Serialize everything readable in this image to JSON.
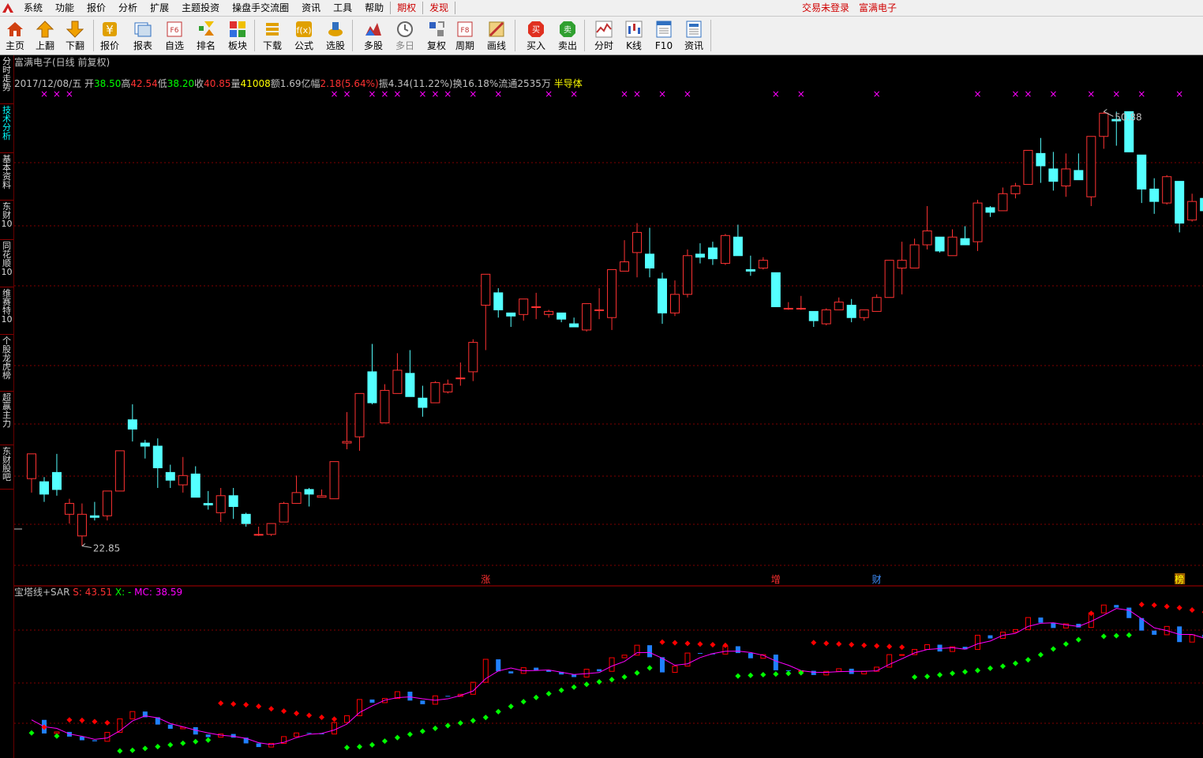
{
  "menubar": {
    "items": [
      "系统",
      "功能",
      "报价",
      "分析",
      "扩展",
      "主题投资",
      "操盘手交流圈",
      "资讯",
      "工具",
      "帮助"
    ],
    "highlight_items": [
      "期权",
      "发现"
    ],
    "login_status": "交易未登录",
    "stock_name": "富满电子"
  },
  "toolbar": {
    "buttons": [
      {
        "label": "主页",
        "icon": "home-icon",
        "color": "#d04010"
      },
      {
        "label": "上翻",
        "icon": "arrow-up-icon",
        "color": "#f0a000"
      },
      {
        "label": "下翻",
        "icon": "arrow-down-icon",
        "color": "#f0a000"
      },
      {
        "label": "报价",
        "icon": "yen-icon",
        "color": "#e0a000"
      },
      {
        "label": "报表",
        "icon": "report-icon",
        "color": "#3070c0"
      },
      {
        "label": "自选",
        "icon": "f6-icon",
        "color": "#c03030"
      },
      {
        "label": "排名",
        "icon": "rank-icon",
        "color": "#e08000"
      },
      {
        "label": "板块",
        "icon": "blocks-icon",
        "color": "#30a030"
      },
      {
        "label": "下载",
        "icon": "download-icon",
        "color": "#e0a000"
      },
      {
        "label": "公式",
        "icon": "formula-icon",
        "color": "#e0a000"
      },
      {
        "label": "选股",
        "icon": "select-stock-icon",
        "color": "#e0a000"
      },
      {
        "label": "多股",
        "icon": "multi-stock-icon",
        "color": "#c03030"
      },
      {
        "label": "多日",
        "icon": "multi-day-icon",
        "color": "#666666",
        "disabled": true
      },
      {
        "label": "复权",
        "icon": "restore-rights-icon",
        "color": "#3060c0"
      },
      {
        "label": "周期",
        "icon": "f8-icon",
        "color": "#c03030"
      },
      {
        "label": "画线",
        "icon": "draw-line-icon",
        "color": "#c03030"
      },
      {
        "label": "买入",
        "icon": "buy-icon",
        "color": "#e03020",
        "glyph": "买"
      },
      {
        "label": "卖出",
        "icon": "sell-icon",
        "color": "#30a030",
        "glyph": "卖"
      },
      {
        "label": "分时",
        "icon": "timeshare-icon",
        "color": "#c03030"
      },
      {
        "label": "K线",
        "icon": "kline-icon",
        "color": "#3060c0"
      },
      {
        "label": "F10",
        "icon": "f10-icon",
        "color": "#3070c0"
      },
      {
        "label": "资讯",
        "icon": "news-icon",
        "color": "#3070c0"
      }
    ]
  },
  "side_tabs": [
    {
      "label": "分时走势",
      "active": false
    },
    {
      "label": "技术分析",
      "active": true
    },
    {
      "label": "基本资料",
      "active": false
    },
    {
      "label": "东财10",
      "active": false
    },
    {
      "label": "同花顺10",
      "active": false
    },
    {
      "label": "维赛特10",
      "active": false
    },
    {
      "label": "个股龙虎榜",
      "active": false
    },
    {
      "label": "超赢主力",
      "active": false
    },
    {
      "label": "东财股吧",
      "active": false
    }
  ],
  "chart_header": {
    "title": "富满电子(日线 前复权)",
    "date": "2017/12/08/五",
    "open_label": "开",
    "open": "38.50",
    "high_label": "高",
    "high": "42.54",
    "low_label": "低",
    "low": "38.20",
    "close_label": "收",
    "close": "40.85",
    "volume_label": "量",
    "volume": "41008",
    "amount_label": "额",
    "amount": "1.69亿",
    "change_label": "幅",
    "change": "2.18(5.64%)",
    "amplitude_label": "振",
    "amplitude": "4.34(11.22%)",
    "turnover_label": "换",
    "turnover": "16.18%",
    "float_label": "流通",
    "float": "2535万",
    "sector": "半导体"
  },
  "colors": {
    "up": "#ff3232",
    "down": "#54ffff",
    "grid": "#800000",
    "ma": "#ff00ff",
    "sar_up": "#00ff00",
    "sar_down": "#ff0000",
    "tower_down": "#2080ff",
    "background": "#000000"
  },
  "event_markers": [
    {
      "label": "涨",
      "color": "#ff3030"
    },
    {
      "label": "增",
      "color": "#ff3030"
    },
    {
      "label": "财",
      "color": "#4090ff"
    },
    {
      "label": "榜",
      "color": "#ffff00",
      "bg": "#a06000"
    }
  ],
  "indicator_header": {
    "name": "宝塔线+SAR",
    "s_label": "S:",
    "s_value": "43.51",
    "x_label": "X:",
    "x_value": "-",
    "mc_label": "MC:",
    "mc_value": "38.59"
  },
  "chart_data": {
    "type": "candlestick",
    "y_range": [
      21.5,
      52.5
    ],
    "max_label": "50.88",
    "min_label": "22.85",
    "candles": [
      [
        27.2,
        28.8,
        26.3,
        27.4
      ],
      [
        27.0,
        26.2,
        25.7,
        27.3
      ],
      [
        27.6,
        26.5,
        26.1,
        28.8
      ],
      [
        24.9,
        25.6,
        24.3,
        25.9
      ],
      [
        23.5,
        24.9,
        22.85,
        25.6
      ],
      [
        24.8,
        24.7,
        24.5,
        25.7
      ],
      [
        24.8,
        26.4,
        24.5,
        26.4
      ],
      [
        26.4,
        29.0,
        26.4,
        29.0
      ],
      [
        31.0,
        30.4,
        29.6,
        32.0
      ],
      [
        29.5,
        29.3,
        28.5,
        29.7
      ],
      [
        29.3,
        27.9,
        26.6,
        29.8
      ],
      [
        27.6,
        27.1,
        26.6,
        28.1
      ],
      [
        26.8,
        27.4,
        26.3,
        28.6
      ],
      [
        27.5,
        26.0,
        26.0,
        28.0
      ],
      [
        25.6,
        25.5,
        25.2,
        26.4
      ],
      [
        25.0,
        26.1,
        24.4,
        26.6
      ],
      [
        26.1,
        25.4,
        24.6,
        26.6
      ],
      [
        24.9,
        24.3,
        24.1,
        25.0
      ],
      [
        23.6,
        23.6,
        23.5,
        24.1
      ],
      [
        23.6,
        24.3,
        23.5,
        24.3
      ],
      [
        24.4,
        25.6,
        24.4,
        25.7
      ],
      [
        25.6,
        26.3,
        25.6,
        27.4
      ],
      [
        26.5,
        26.2,
        25.4,
        26.6
      ],
      [
        26.0,
        26.1,
        26.0,
        26.5
      ],
      [
        25.9,
        28.3,
        25.9,
        28.3
      ],
      [
        29.5,
        29.6,
        29.1,
        31.5
      ],
      [
        29.9,
        32.7,
        29.0,
        32.7
      ],
      [
        34.1,
        32.1,
        32.0,
        35.9
      ],
      [
        30.8,
        32.9,
        30.8,
        33.3
      ],
      [
        32.7,
        34.2,
        32.7,
        35.3
      ],
      [
        34.0,
        32.5,
        32.5,
        35.5
      ],
      [
        32.4,
        31.8,
        31.2,
        33.2
      ],
      [
        32.1,
        33.4,
        32.1,
        33.5
      ],
      [
        32.8,
        33.3,
        32.7,
        33.6
      ],
      [
        33.7,
        33.7,
        33.2,
        34.7
      ],
      [
        34.1,
        36.0,
        33.5,
        36.2
      ],
      [
        38.4,
        40.4,
        35.5,
        40.4
      ],
      [
        39.2,
        38.1,
        37.6,
        39.5
      ],
      [
        37.9,
        37.7,
        37.0,
        37.9
      ],
      [
        37.8,
        38.8,
        37.4,
        38.8
      ],
      [
        38.3,
        38.3,
        37.5,
        39.2
      ],
      [
        37.8,
        38.0,
        37.6,
        38.1
      ],
      [
        37.9,
        37.5,
        37.3,
        37.9
      ],
      [
        37.2,
        37.0,
        37.0,
        37.6
      ],
      [
        36.8,
        38.5,
        36.7,
        38.5
      ],
      [
        38.1,
        38.1,
        37.5,
        39.5
      ],
      [
        37.6,
        40.7,
        36.8,
        40.7
      ],
      [
        40.6,
        41.2,
        40.6,
        42.6
      ],
      [
        41.8,
        43.1,
        40.2,
        43.7
      ],
      [
        41.7,
        40.8,
        40.2,
        43.4
      ],
      [
        40.1,
        37.9,
        37.2,
        40.5
      ],
      [
        37.9,
        39.1,
        37.7,
        40.0
      ],
      [
        39.1,
        41.6,
        38.9,
        42.0
      ],
      [
        41.7,
        41.5,
        41.1,
        42.4
      ],
      [
        42.1,
        41.4,
        41.0,
        42.5
      ],
      [
        41.1,
        42.9,
        41.0,
        43.0
      ],
      [
        42.8,
        41.6,
        41.6,
        43.6
      ],
      [
        40.7,
        40.6,
        40.3,
        41.6
      ],
      [
        40.8,
        41.3,
        40.7,
        41.5
      ],
      [
        40.5,
        38.3,
        38.3,
        40.5
      ],
      [
        38.2,
        38.2,
        38.1,
        38.6
      ],
      [
        38.2,
        38.2,
        38.1,
        39.0
      ],
      [
        38.0,
        37.4,
        37.0,
        38.0
      ],
      [
        37.2,
        38.1,
        37.1,
        38.2
      ],
      [
        38.1,
        38.6,
        38.1,
        38.9
      ],
      [
        38.4,
        37.6,
        37.3,
        38.8
      ],
      [
        37.6,
        38.1,
        37.4,
        38.1
      ],
      [
        38.0,
        38.9,
        38.0,
        39.1
      ],
      [
        38.9,
        41.3,
        38.9,
        41.3
      ],
      [
        40.8,
        41.3,
        39.1,
        42.5
      ],
      [
        40.8,
        42.3,
        40.8,
        42.7
      ],
      [
        42.3,
        43.2,
        42.0,
        44.8
      ],
      [
        42.8,
        41.9,
        41.8,
        42.8
      ],
      [
        41.6,
        42.8,
        41.6,
        43.3
      ],
      [
        42.7,
        42.3,
        42.3,
        43.5
      ],
      [
        42.5,
        45.0,
        41.9,
        45.2
      ],
      [
        44.7,
        44.4,
        44.1,
        44.8
      ],
      [
        44.5,
        45.6,
        44.5,
        46.0
      ],
      [
        45.6,
        46.1,
        45.3,
        46.3
      ],
      [
        46.2,
        48.4,
        46.2,
        48.4
      ],
      [
        48.2,
        47.4,
        46.3,
        49.2
      ],
      [
        47.2,
        46.4,
        45.8,
        48.3
      ],
      [
        46.1,
        47.2,
        45.4,
        48.2
      ],
      [
        47.1,
        46.5,
        46.5,
        48.2
      ],
      [
        45.4,
        49.3,
        44.8,
        49.3
      ],
      [
        49.3,
        50.8,
        48.5,
        50.9
      ],
      [
        50.4,
        50.3,
        48.7,
        50.9
      ],
      [
        50.9,
        48.3,
        48.3,
        50.9
      ],
      [
        48.1,
        45.9,
        45.0,
        48.1
      ],
      [
        45.9,
        45.1,
        44.3,
        46.6
      ],
      [
        45.0,
        46.7,
        44.9,
        46.8
      ],
      [
        46.4,
        43.7,
        43.1,
        46.4
      ],
      [
        43.9,
        45.1,
        43.8,
        45.6
      ],
      [
        45.3,
        44.5,
        44.1,
        45.6
      ],
      [
        44.6,
        42.6,
        42.4,
        44.8
      ]
    ],
    "indicator": {
      "name": "宝塔线+SAR",
      "y_range": [
        21.5,
        52.5
      ]
    }
  }
}
